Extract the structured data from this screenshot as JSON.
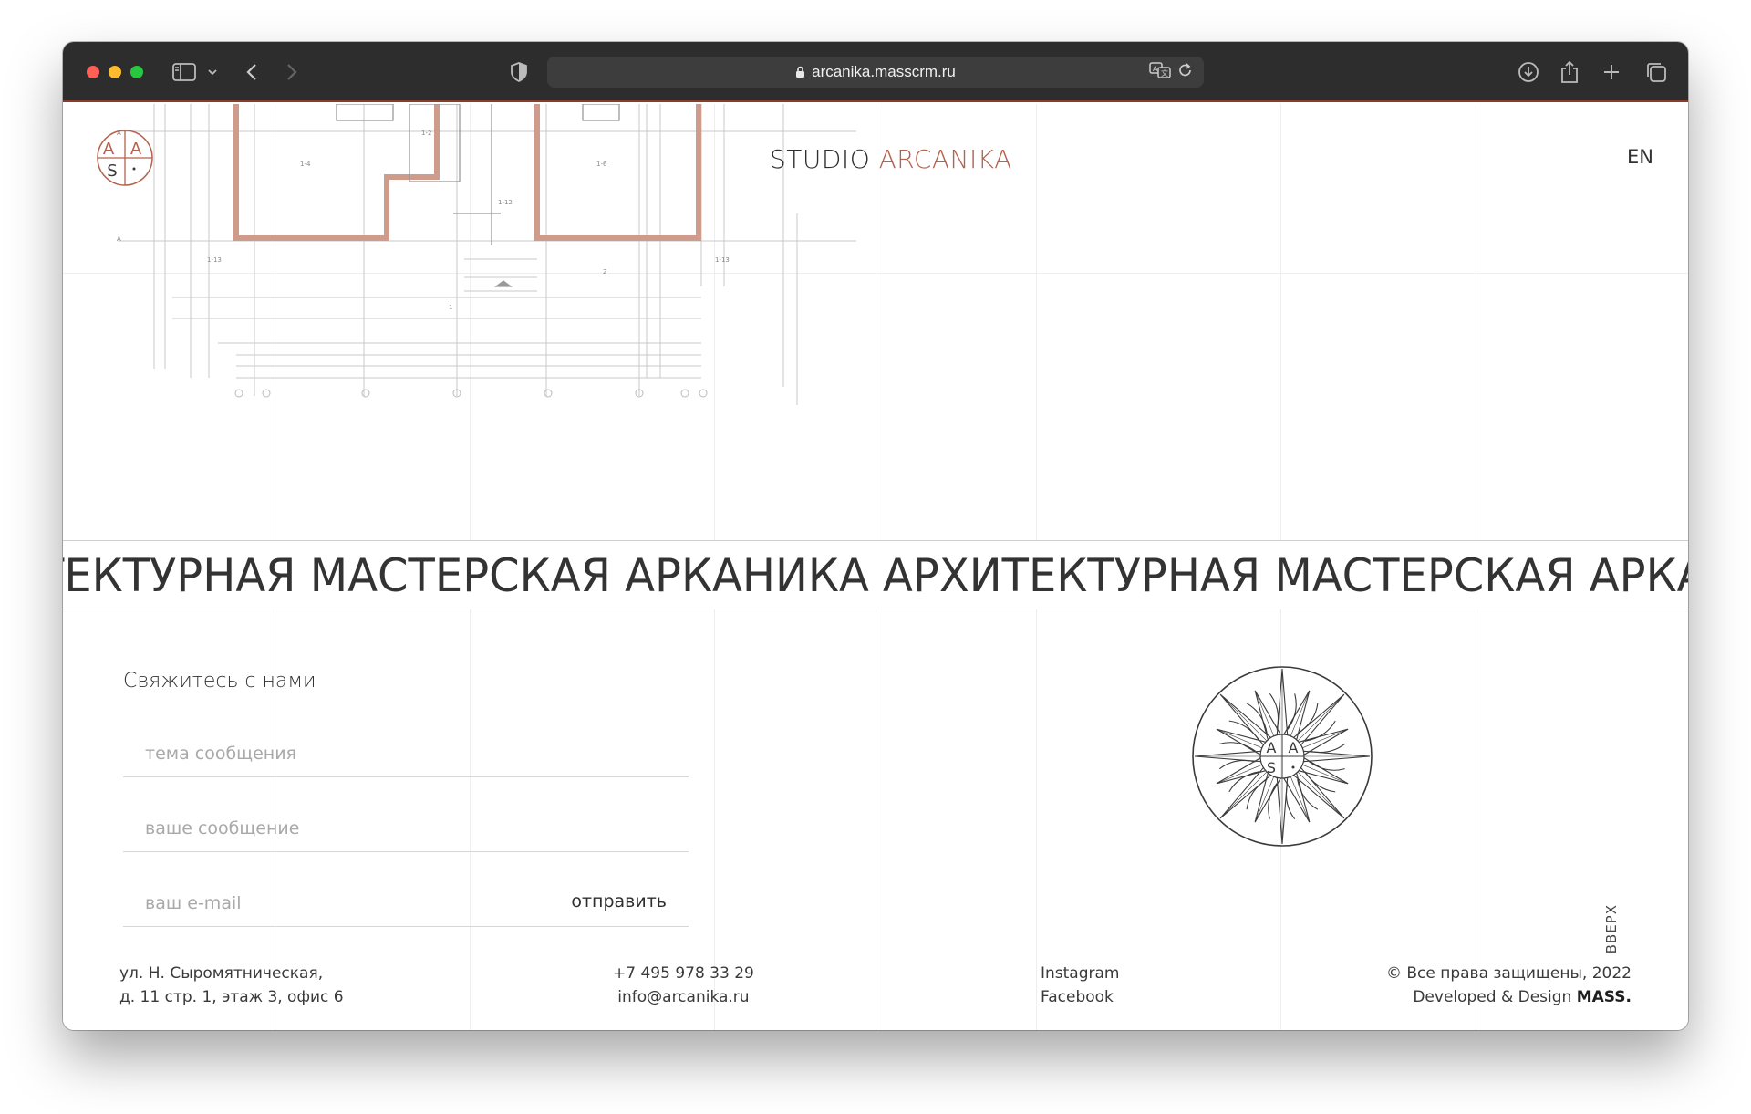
{
  "browser": {
    "url": "arcanika.masscrm.ru"
  },
  "header": {
    "logo_letters": [
      "A",
      "A",
      "S"
    ],
    "brand_part1": "STUDIO ",
    "brand_part2": "ARCANIKA",
    "lang": "EN"
  },
  "marquee": {
    "text": "ТЕКТУРНАЯ МАСТЕРСКАЯ АРКАНИКА АРХИТЕКТУРНАЯ МАСТЕРСКАЯ АРКАНИКА"
  },
  "contact": {
    "title": "Свяжитесь с нами",
    "subject_placeholder": "тема сообщения",
    "message_placeholder": "ваше сообщение",
    "email_placeholder": "ваш e-mail",
    "send_label": "отправить"
  },
  "to_top": "ВВЕРХ",
  "footer": {
    "address_line1": "ул. Н. Сыромятническая,",
    "address_line2": "д. 11 стр. 1, этаж 3, офис 6",
    "phone": "+7 495 978 33 29",
    "email": "info@arcanika.ru",
    "instagram": "Instagram",
    "facebook": "Facebook",
    "copyright": "© Все права защищены, 2022",
    "developed_prefix": "Developed & Design ",
    "developed_brand": "MASS."
  },
  "colors": {
    "accent": "#b4614d",
    "toolbar": "#2d2d2d"
  }
}
